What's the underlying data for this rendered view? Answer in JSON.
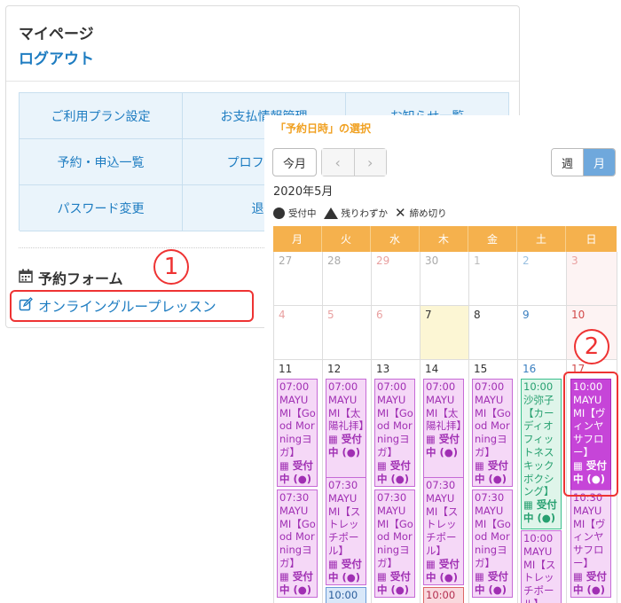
{
  "mypage": {
    "title": "マイページ",
    "logout": "ログアウト",
    "menu": [
      "ご利用プラン設定",
      "お支払情報管理",
      "お知らせ一覧",
      "予約・申込一覧",
      "プロフィール",
      "",
      "パスワード変更",
      "退会",
      ""
    ],
    "form_heading": "予約フォーム",
    "online_lesson_link": "オンライングループレッスン"
  },
  "annotations": {
    "callout_1": "1",
    "callout_2": "2"
  },
  "calendar": {
    "title": "「予約日時」の選択",
    "today_button": "今月",
    "week_button": "週",
    "month_button": "月",
    "month_title": "2020年5月",
    "legend": {
      "available": "受付中",
      "few_left": "残りわずか",
      "closed": "締め切り"
    },
    "weekdays": [
      "月",
      "火",
      "水",
      "木",
      "金",
      "土",
      "日"
    ],
    "week1": [
      "27",
      "28",
      "29",
      "30",
      "1",
      "2",
      "3"
    ],
    "week2": [
      "4",
      "5",
      "6",
      "7",
      "8",
      "9",
      "10"
    ],
    "week3": [
      "11",
      "12",
      "13",
      "14",
      "15",
      "16",
      "17"
    ],
    "events": {
      "mon_1": {
        "time": "07:00",
        "title": "MAYUMI【Good Morningヨガ】",
        "status": "受付中 (●)"
      },
      "mon_2": {
        "time": "07:30",
        "title": "MAYUMI【Good Morningヨガ】",
        "status": "受付中 (●)"
      },
      "tue_1": {
        "time": "07:00",
        "title": "MAYUMI【太陽礼拝】",
        "status": "受付中 (●)"
      },
      "tue_2": {
        "time": "07:30",
        "title": "MAYUMI【ストレッチポール】",
        "status": "受付中 (●)"
      },
      "tue_3": {
        "time": "10:00"
      },
      "wed_1": {
        "time": "07:00",
        "title": "MAYUMI【Good Morningヨガ】",
        "status": "受付中 (●)"
      },
      "wed_2": {
        "time": "07:30",
        "title": "MAYUMI【Good Morningヨガ】",
        "status": "受付中 (●)"
      },
      "thu_1": {
        "time": "07:00",
        "title": "MAYUMI【太陽礼拝】",
        "status": "受付中 (●)"
      },
      "thu_2": {
        "time": "07:30",
        "title": "MAYUMI【ストレッチポール】",
        "status": "受付中 (●)"
      },
      "thu_3": {
        "time": "10:00"
      },
      "fri_1": {
        "time": "07:00",
        "title": "MAYUMI【Good Morningヨガ】",
        "status": "受付中 (●)"
      },
      "fri_2": {
        "time": "07:30",
        "title": "MAYUMI【Good Morningヨガ】",
        "status": "受付中 (●)"
      },
      "sat_1": {
        "time": "10:00",
        "title": "沙弥子【カーディオフィットネスキックボクシング】",
        "status": "受付中 (●)"
      },
      "sat_2": {
        "time": "10:00",
        "title": "MAYUMI【ストレッチポール】"
      },
      "sun_1": {
        "time": "10:00",
        "title": "MAYUMI【ヴィンヤサフロー】",
        "status": "受付中 (●)"
      },
      "sun_2": {
        "time": "10:30",
        "title": "MAYUMI【ヴィンヤサフロー】",
        "status": "受付中 (●)"
      }
    }
  },
  "colors": {
    "link_blue": "#1d7cc1",
    "header_orange": "#f5b14d",
    "event_purple": "#c645d8",
    "event_green": "#3bbf8c",
    "callout_red": "#e33333"
  }
}
